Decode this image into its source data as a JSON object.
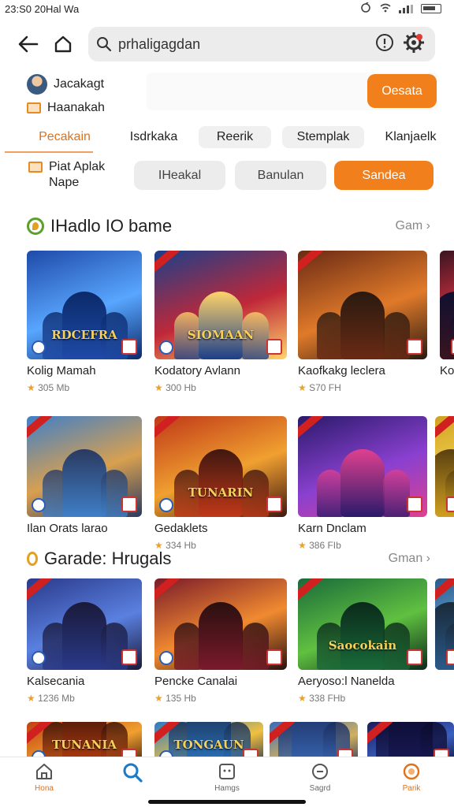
{
  "status_bar": {
    "time": "23:S0 20Hal Wa"
  },
  "app_bar": {
    "search_value": "prhaligagdan"
  },
  "account": {
    "name": "Jacakagt",
    "sub": "Haanakah",
    "promo_button": "Oesata"
  },
  "tabs": [
    "Pecakain",
    "Isdrkaka",
    "Reerik",
    "Stemplak",
    "Klanjaelk"
  ],
  "filter": {
    "label_line1": "Piat Aplak",
    "label_line2": "Nape",
    "chips": [
      "IHeakal",
      "Banulan",
      "Sandea"
    ]
  },
  "sections": [
    {
      "title": "IHadlo IO bame",
      "more": "Gam"
    },
    {
      "title": "Garade: Hrugals",
      "more": "Gman"
    }
  ],
  "cards": [
    {
      "name": "Kolig Mamah",
      "meta": "305 Mb",
      "banner": "RDCEFRA",
      "colors": [
        "#1f4aa8",
        "#58a6ff",
        "#0b2a6a"
      ]
    },
    {
      "name": "Kodatory Avlann",
      "meta": "300 Hb",
      "banner": "SIOMAAN",
      "colors": [
        "#1b3f8a",
        "#c02838",
        "#ffd36a"
      ]
    },
    {
      "name": "Kaofkakg leclera",
      "meta": "S70 FH",
      "banner": "",
      "colors": [
        "#6a2a14",
        "#e07a2a",
        "#2a1a10"
      ]
    },
    {
      "name": "Kol",
      "meta": "",
      "banner": "",
      "colors": [
        "#3a1420",
        "#d03040",
        "#101030"
      ]
    },
    {
      "name": "Ilan Orats larao",
      "meta": "",
      "banner": "",
      "colors": [
        "#3f7fc8",
        "#d8a050",
        "#2a3a60"
      ]
    },
    {
      "name": "Gedaklets",
      "meta": "334 Hb",
      "banner": "TUNARIN",
      "colors": [
        "#c03818",
        "#f0a030",
        "#401810"
      ]
    },
    {
      "name": "Karn Dnclam",
      "meta": "386 FIb",
      "banner": "",
      "colors": [
        "#2a1a6a",
        "#8a40d0",
        "#e04090"
      ]
    },
    {
      "name": "",
      "meta": "",
      "banner": "",
      "colors": [
        "#d0a020",
        "#f0d050",
        "#5a4010"
      ]
    },
    {
      "name": "Kalsecania",
      "meta": "1236 Mb",
      "banner": "",
      "colors": [
        "#2a3a8a",
        "#5a80e0",
        "#1a1a3a"
      ]
    },
    {
      "name": "Pencke Canalai",
      "meta": "135 Hb",
      "banner": "",
      "colors": [
        "#7a1a2a",
        "#f08a30",
        "#2a1010"
      ]
    },
    {
      "name": "Aeryoso:l Nanelda",
      "meta": "338 FHb",
      "banner": "Saocokain",
      "colors": [
        "#1a6a3a",
        "#60c040",
        "#0a2a1a"
      ]
    },
    {
      "name": "",
      "meta": "",
      "banner": "",
      "colors": [
        "#2a5a8a",
        "#60a0d0",
        "#1a2a3a"
      ]
    },
    {
      "name": "",
      "meta": "",
      "banner": "TUNANIA",
      "colors": [
        "#c04010",
        "#f0a030",
        "#301008"
      ]
    },
    {
      "name": "",
      "meta": "",
      "banner": "TONGAUN",
      "colors": [
        "#2a7ac8",
        "#f0c040",
        "#1a2a4a"
      ]
    },
    {
      "name": "",
      "meta": "",
      "banner": "",
      "colors": [
        "#3a6ab8",
        "#d0b060",
        "#1a2a5a"
      ]
    },
    {
      "name": "",
      "meta": "",
      "banner": "",
      "colors": [
        "#1a1a5a",
        "#3a60c0",
        "#0a0a2a"
      ]
    }
  ],
  "bottom_nav": [
    {
      "label": "Hona",
      "icon": "home-icon"
    },
    {
      "label": "",
      "icon": "search-icon"
    },
    {
      "label": "Hamgs",
      "icon": "games-icon"
    },
    {
      "label": "Sagrd",
      "icon": "chat-icon"
    },
    {
      "label": "Parik",
      "icon": "profile-icon"
    }
  ],
  "accent_color": "#f07f1c"
}
